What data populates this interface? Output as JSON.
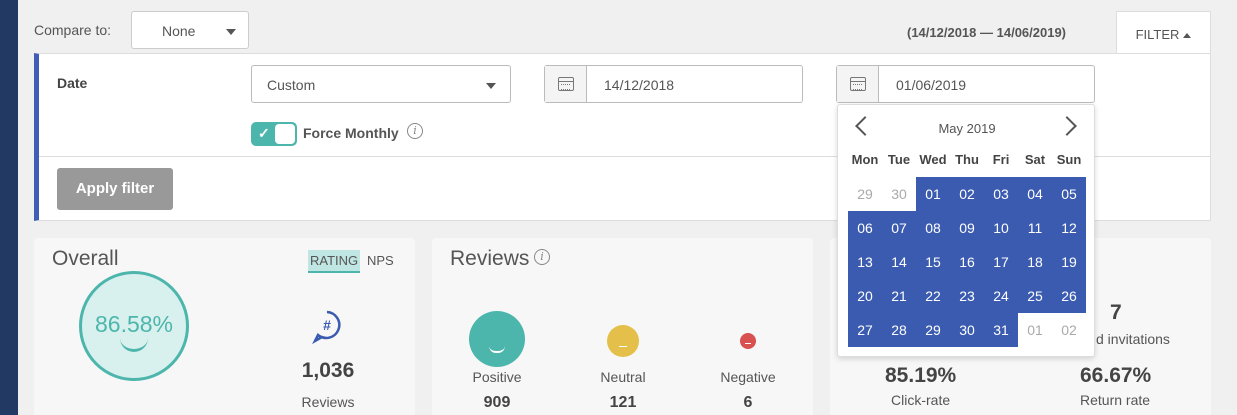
{
  "compare": {
    "label": "Compare to:",
    "value": "None"
  },
  "range_text": "(14/12/2018 — 14/06/2019)",
  "filter_tab": "FILTER",
  "filter": {
    "date_label": "Date",
    "period_value": "Custom",
    "start_date": "14/12/2018",
    "end_date": "01/06/2019",
    "force_monthly_label": "Force Monthly",
    "force_monthly_on": true,
    "apply_label": "Apply filter"
  },
  "overall": {
    "title": "Overall",
    "rating_tab": "RATING",
    "nps_tab": "NPS",
    "score": "86.58%",
    "reviews_count": "1,036",
    "reviews_label": "Reviews"
  },
  "reviews": {
    "title": "Reviews",
    "positive_label": "Positive",
    "positive_count": "909",
    "neutral_label": "Neutral",
    "neutral_count": "121",
    "negative_label": "Negative",
    "negative_count": "6"
  },
  "invitations": {
    "invitations_count": "7",
    "invitations_label_partial": "d invitations",
    "click_rate": "85.19%",
    "click_rate_label": "Click-rate",
    "return_rate": "66.67%",
    "return_rate_label": "Return rate"
  },
  "datepicker": {
    "month": "May 2019",
    "weekdays": [
      "Mon",
      "Tue",
      "Wed",
      "Thu",
      "Fri",
      "Sat",
      "Sun"
    ],
    "days": [
      {
        "d": "29",
        "in": false
      },
      {
        "d": "30",
        "in": false
      },
      {
        "d": "01",
        "in": true
      },
      {
        "d": "02",
        "in": true
      },
      {
        "d": "03",
        "in": true
      },
      {
        "d": "04",
        "in": true
      },
      {
        "d": "05",
        "in": true
      },
      {
        "d": "06",
        "in": true
      },
      {
        "d": "07",
        "in": true
      },
      {
        "d": "08",
        "in": true
      },
      {
        "d": "09",
        "in": true
      },
      {
        "d": "10",
        "in": true
      },
      {
        "d": "11",
        "in": true
      },
      {
        "d": "12",
        "in": true
      },
      {
        "d": "13",
        "in": true
      },
      {
        "d": "14",
        "in": true
      },
      {
        "d": "15",
        "in": true
      },
      {
        "d": "16",
        "in": true
      },
      {
        "d": "17",
        "in": true
      },
      {
        "d": "18",
        "in": true
      },
      {
        "d": "19",
        "in": true
      },
      {
        "d": "20",
        "in": true
      },
      {
        "d": "21",
        "in": true
      },
      {
        "d": "22",
        "in": true
      },
      {
        "d": "23",
        "in": true
      },
      {
        "d": "24",
        "in": true
      },
      {
        "d": "25",
        "in": true
      },
      {
        "d": "26",
        "in": true
      },
      {
        "d": "27",
        "in": true
      },
      {
        "d": "28",
        "in": true
      },
      {
        "d": "29",
        "in": true
      },
      {
        "d": "30",
        "in": true
      },
      {
        "d": "31",
        "in": true
      },
      {
        "d": "01",
        "in": false
      },
      {
        "d": "02",
        "in": false
      }
    ]
  },
  "colors": {
    "accent": "#3a5bb0",
    "teal": "#4db6ac",
    "neutral": "#e4c04a",
    "negative": "#d95050",
    "sidebar": "#223a63"
  }
}
